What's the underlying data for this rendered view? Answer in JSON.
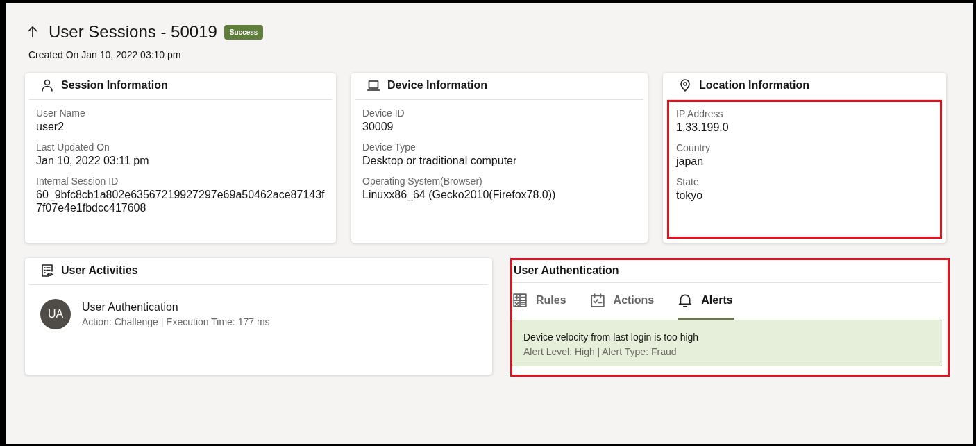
{
  "header": {
    "title": "User Sessions - 50019",
    "status_badge": "Success",
    "created": "Created On Jan 10, 2022 03:10 pm"
  },
  "info_cards": [
    {
      "kind": "session",
      "title": "Session Information",
      "highlighted": false,
      "fields": [
        {
          "label": "User Name",
          "value": "user2"
        },
        {
          "label": "Last Updated On",
          "value": "Jan 10, 2022 03:11 pm"
        },
        {
          "label": "Internal Session ID",
          "value": "60_9bfc8cb1a802e63567219927297e69a50462ace87143f7f07e4e1fbdcc417608"
        }
      ]
    },
    {
      "kind": "device",
      "title": "Device Information",
      "highlighted": false,
      "fields": [
        {
          "label": "Device ID",
          "value": "30009"
        },
        {
          "label": "Device Type",
          "value": "Desktop or traditional computer"
        },
        {
          "label": "Operating System(Browser)",
          "value": "Linuxx86_64 (Gecko2010(Firefox78.0))"
        }
      ]
    },
    {
      "kind": "location",
      "title": "Location Information",
      "highlighted": true,
      "fields": [
        {
          "label": "IP Address",
          "value": "1.33.199.0"
        },
        {
          "label": "Country",
          "value": "japan"
        },
        {
          "label": "State",
          "value": "tokyo"
        }
      ]
    }
  ],
  "activities": {
    "title": "User Activities",
    "items": [
      {
        "initials": "UA",
        "name": "User Authentication",
        "detail": "Action: Challenge | Execution Time: 177 ms"
      }
    ]
  },
  "auth_panel": {
    "title": "User Authentication",
    "highlighted": true,
    "tabs": [
      {
        "kind": "rules",
        "label": "Rules",
        "selected": false
      },
      {
        "kind": "actions",
        "label": "Actions",
        "selected": false
      },
      {
        "kind": "alerts",
        "label": "Alerts",
        "selected": true
      }
    ],
    "alerts": [
      {
        "message": "Device velocity from last login is too high",
        "detail": "Alert Level: High | Alert Type: Fraud"
      }
    ]
  }
}
